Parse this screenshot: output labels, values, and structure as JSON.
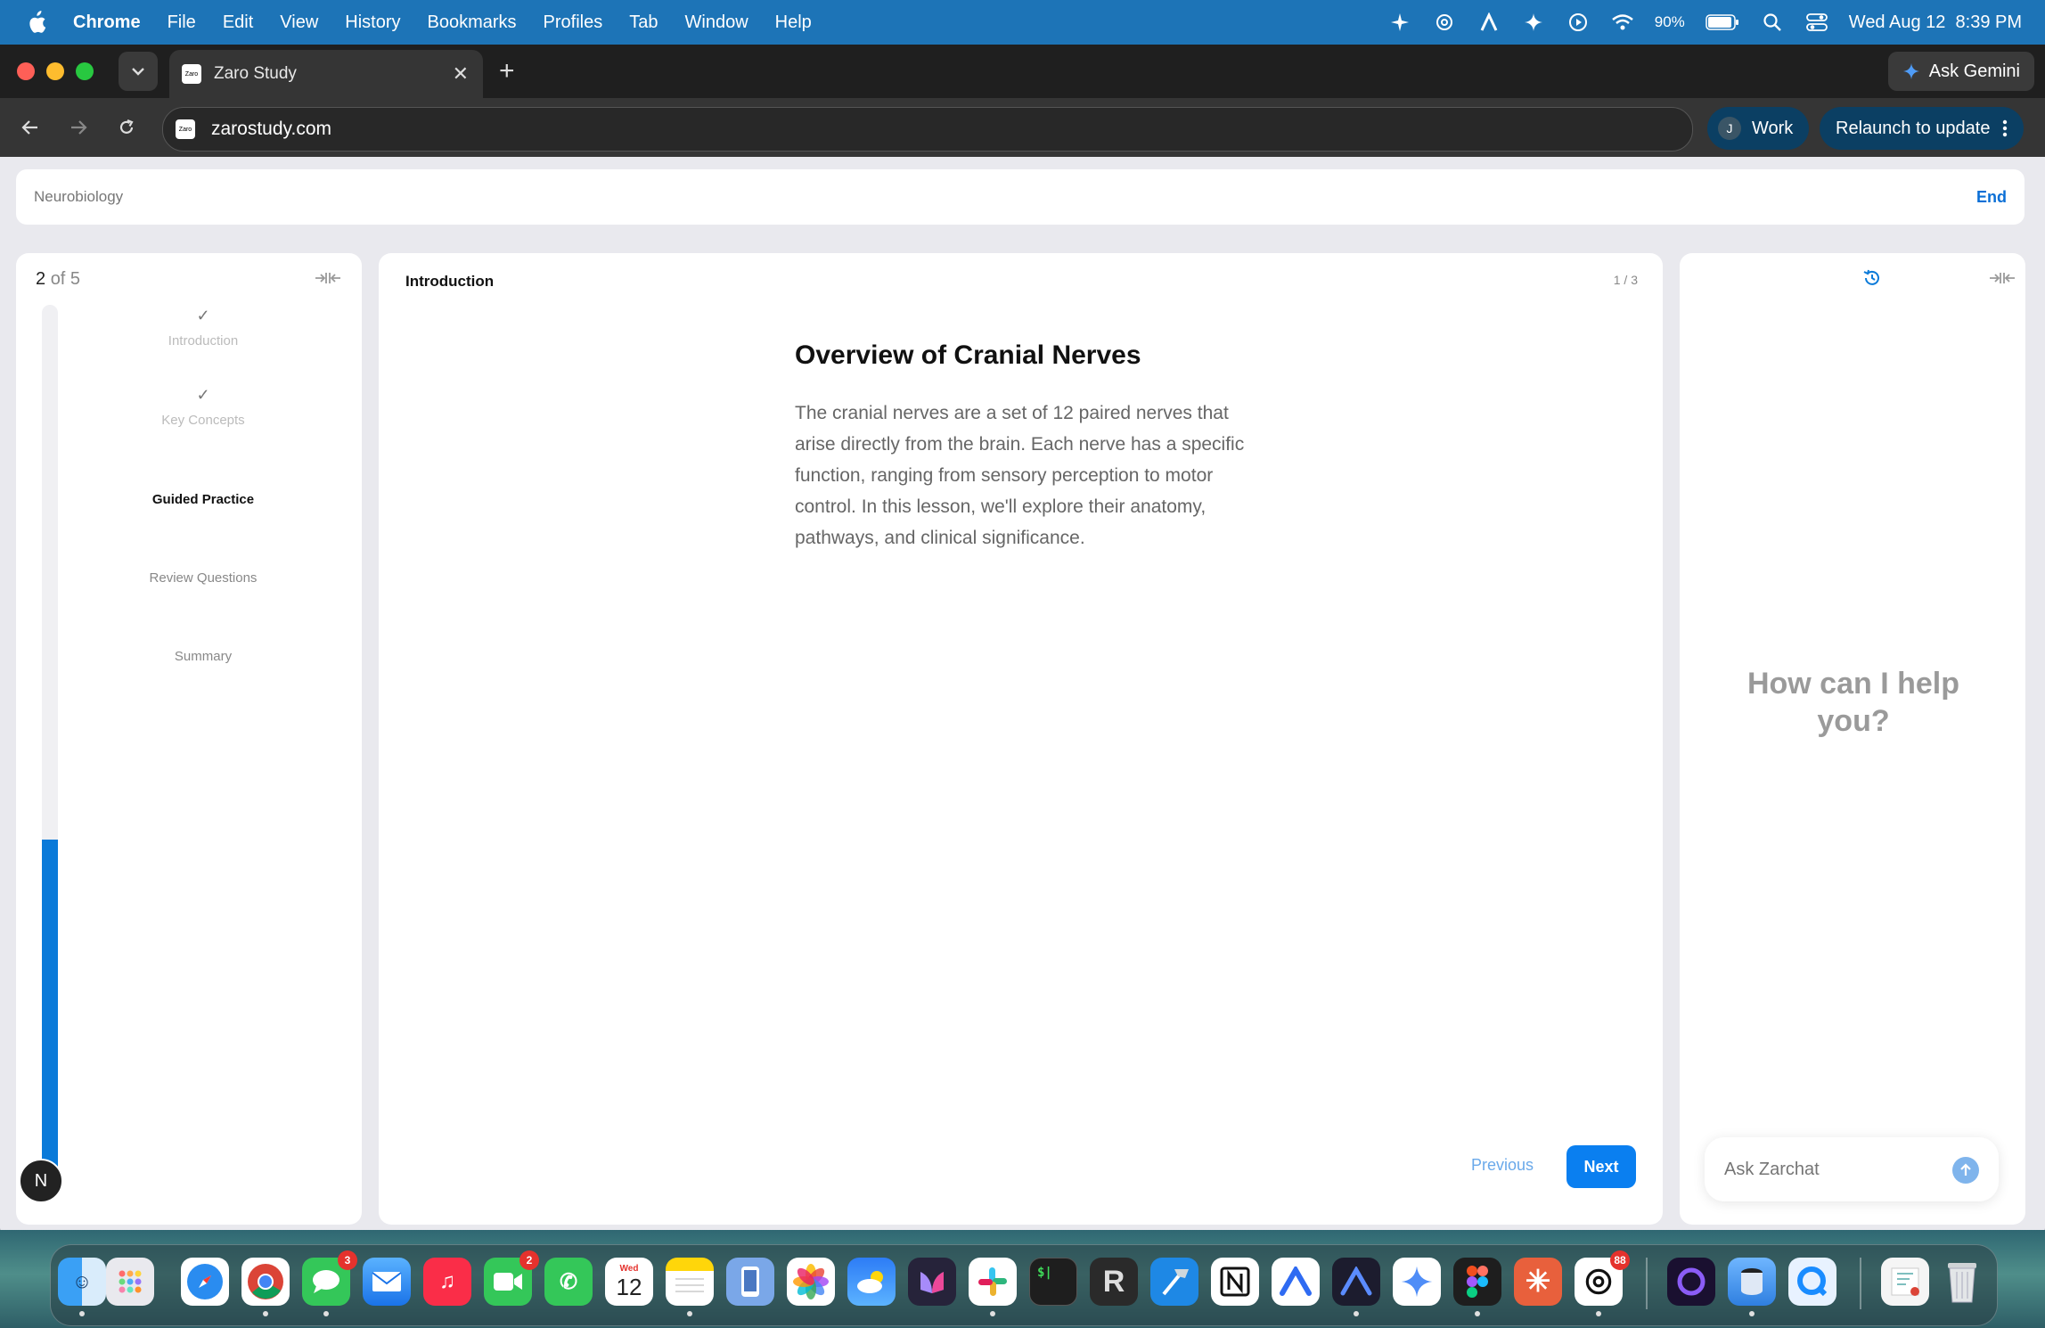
{
  "menubar": {
    "app_name": "Chrome",
    "menus": [
      "File",
      "Edit",
      "View",
      "History",
      "Bookmarks",
      "Profiles",
      "Tab",
      "Window",
      "Help"
    ],
    "battery": "90%",
    "datetime": "Wed Aug 12  8:39 PM"
  },
  "browser": {
    "tab_title": "Zaro Study",
    "favicon_text": "Zaro",
    "url": "zarostudy.com",
    "gemini_label": "Ask Gemini",
    "profile_initial": "J",
    "profile_name": "Work",
    "relaunch_label": "Relaunch to update"
  },
  "lesson": {
    "course": "Neurobiology",
    "end_label": "End",
    "progress_current": "2",
    "progress_of": "of 5",
    "progress_fraction": 0.4,
    "steps": [
      {
        "label": "Introduction",
        "done": true,
        "check": "✓"
      },
      {
        "label": "Key Concepts",
        "done": true,
        "check": "✓"
      },
      {
        "label": "Guided Practice",
        "done": false,
        "check": ""
      },
      {
        "label": "Review Questions",
        "done": false,
        "check": ""
      },
      {
        "label": "Summary",
        "done": false,
        "check": ""
      }
    ],
    "section_title": "Introduction",
    "pager": "1 / 3",
    "heading": "Overview of Cranial Nerves",
    "body": "The cranial nerves are a set of 12 paired nerves that arise directly from the brain. Each nerve has a specific function, ranging from sensory perception to motor control. In this lesson, we'll explore their anatomy, pathways, and clinical significance.",
    "prev_label": "Previous",
    "next_label": "Next",
    "user_initial": "N"
  },
  "chat": {
    "heading": "How can I help you?",
    "placeholder": "Ask Zarchat"
  },
  "dock": {
    "calendar_month": "Wed",
    "calendar_day": "12",
    "messages_badge": "3",
    "facetime_badge": "2",
    "chatgpt_badge": "88"
  },
  "colors": {
    "accent": "#0a7ad9",
    "menubar": "#1d74b7",
    "next_button": "#0a7ff0"
  }
}
